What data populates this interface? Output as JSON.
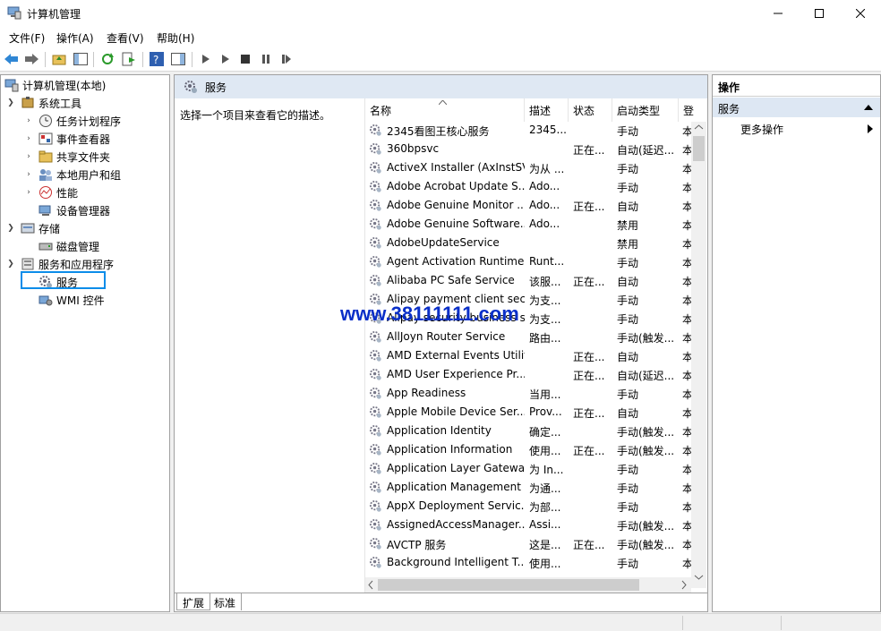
{
  "window": {
    "title": "计算机管理"
  },
  "menu": [
    "文件(F)",
    "操作(A)",
    "查看(V)",
    "帮助(H)"
  ],
  "tree": {
    "root": "计算机管理(本地)",
    "items": [
      {
        "label": "系统工具",
        "level": 1,
        "expanded": true
      },
      {
        "label": "任务计划程序",
        "level": 2,
        "expanded": false
      },
      {
        "label": "事件查看器",
        "level": 2,
        "expanded": false
      },
      {
        "label": "共享文件夹",
        "level": 2,
        "expanded": false
      },
      {
        "label": "本地用户和组",
        "level": 2,
        "expanded": false
      },
      {
        "label": "性能",
        "level": 2,
        "expanded": false
      },
      {
        "label": "设备管理器",
        "level": 2,
        "expanded": null
      },
      {
        "label": "存储",
        "level": 1,
        "expanded": true
      },
      {
        "label": "磁盘管理",
        "level": 2,
        "expanded": null
      },
      {
        "label": "服务和应用程序",
        "level": 1,
        "expanded": true
      },
      {
        "label": "服务",
        "level": 2,
        "expanded": null
      },
      {
        "label": "WMI 控件",
        "level": 2,
        "expanded": null
      }
    ]
  },
  "center": {
    "header": "服务",
    "description": "选择一个项目来查看它的描述。",
    "columns": [
      "名称",
      "描述",
      "状态",
      "启动类型",
      "登"
    ],
    "rows": [
      [
        "2345看图王核心服务",
        "2345...",
        "",
        "手动",
        "本"
      ],
      [
        "360bpsvc",
        "",
        "正在...",
        "自动(延迟...",
        "本"
      ],
      [
        "ActiveX Installer (AxInstSV)",
        "为从 ...",
        "",
        "手动",
        "本"
      ],
      [
        "Adobe Acrobat Update S...",
        "Ado...",
        "",
        "手动",
        "本"
      ],
      [
        "Adobe Genuine Monitor ...",
        "Ado...",
        "正在...",
        "自动",
        "本"
      ],
      [
        "Adobe Genuine Software...",
        "Ado...",
        "",
        "禁用",
        "本"
      ],
      [
        "AdobeUpdateService",
        "",
        "",
        "禁用",
        "本"
      ],
      [
        "Agent Activation Runtime...",
        "Runt...",
        "",
        "手动",
        "本"
      ],
      [
        "Alibaba PC Safe Service",
        "该服...",
        "正在...",
        "自动",
        "本"
      ],
      [
        "Alipay payment client sec...",
        "为支...",
        "",
        "手动",
        "本"
      ],
      [
        "Alipay security business s...",
        "为支...",
        "",
        "手动",
        "本"
      ],
      [
        "AllJoyn Router Service",
        "路由...",
        "",
        "手动(触发...",
        "本"
      ],
      [
        "AMD External Events Utility",
        "",
        "正在...",
        "自动",
        "本"
      ],
      [
        "AMD User Experience Pr...",
        "",
        "正在...",
        "自动(延迟...",
        "本"
      ],
      [
        "App Readiness",
        "当用...",
        "",
        "手动",
        "本"
      ],
      [
        "Apple Mobile Device Ser...",
        "Prov...",
        "正在...",
        "自动",
        "本"
      ],
      [
        "Application Identity",
        "确定...",
        "",
        "手动(触发...",
        "本"
      ],
      [
        "Application Information",
        "使用...",
        "正在...",
        "手动(触发...",
        "本"
      ],
      [
        "Application Layer Gatewa...",
        "为 In...",
        "",
        "手动",
        "本"
      ],
      [
        "Application Management",
        "为通...",
        "",
        "手动",
        "本"
      ],
      [
        "AppX Deployment Servic...",
        "为部...",
        "",
        "手动",
        "本"
      ],
      [
        "AssignedAccessManager...",
        "Assi...",
        "",
        "手动(触发...",
        "本"
      ],
      [
        "AVCTP 服务",
        "这是...",
        "正在...",
        "手动(触发...",
        "本"
      ],
      [
        "Background Intelligent T...",
        "使用...",
        "",
        "手动",
        "本"
      ]
    ],
    "tabs": [
      "扩展",
      "标准"
    ]
  },
  "actions": {
    "header": "操作",
    "section": "服务",
    "items": [
      "更多操作"
    ]
  },
  "watermark": "www.38111111.com",
  "colors": {
    "accent": "#0c8ce9",
    "header_bg": "#dfe8f3"
  }
}
